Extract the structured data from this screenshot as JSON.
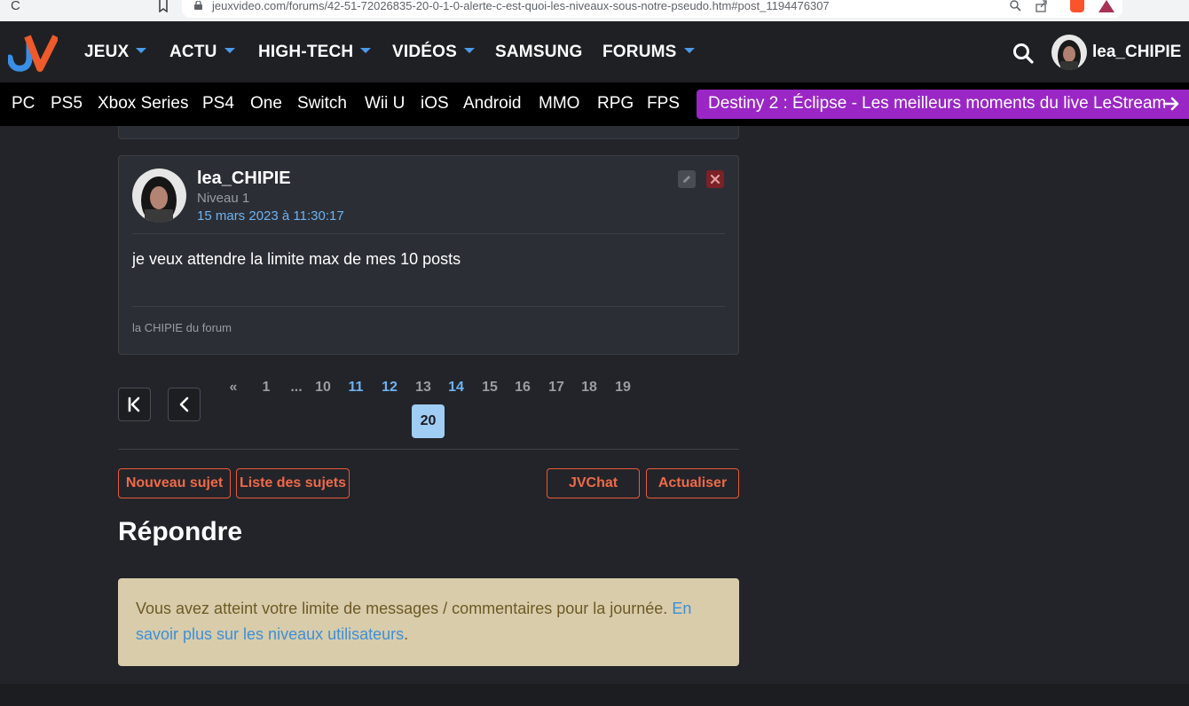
{
  "browser": {
    "url": "jeuxvideo.com/forums/42-51-72026835-20-0-1-0-alerte-c-est-quoi-les-niveaux-sous-notre-pseudo.htm#post_1194476307",
    "reload_icon": "C",
    "brave_badge": "1"
  },
  "header": {
    "logo": "JV",
    "nav": [
      {
        "label": "JEUX",
        "dropdown": true
      },
      {
        "label": "ACTU",
        "dropdown": true
      },
      {
        "label": "HIGH-TECH",
        "dropdown": true
      },
      {
        "label": "VIDÉOS",
        "dropdown": true
      },
      {
        "label": "SAMSUNG",
        "dropdown": false
      },
      {
        "label": "FORUMS",
        "dropdown": true
      }
    ],
    "username": "lea_CHIPIE"
  },
  "platforms": [
    "PC",
    "PS5",
    "Xbox Series",
    "PS4",
    "One",
    "Switch",
    "Wii U",
    "iOS",
    "Android",
    "MMO",
    "RPG",
    "FPS"
  ],
  "promo": {
    "text": "Destiny 2 : Éclipse - Les meilleurs moments du live LeStream",
    "color": "#9a27c5"
  },
  "post": {
    "author": "lea_CHIPIE",
    "level": "Niveau 1",
    "date": "15 mars 2023 à 11:30:17",
    "message": "je veux attendre la limite max de mes 10 posts",
    "signature": "la CHIPIE du forum"
  },
  "pagination": {
    "first": "«",
    "pages": [
      "1",
      "...",
      "10",
      "11",
      "12",
      "13",
      "14",
      "15",
      "16",
      "17",
      "18",
      "19"
    ],
    "current": "20"
  },
  "actions": {
    "new_topic": "Nouveau sujet",
    "topic_list": "Liste des sujets",
    "jvchat": "JVChat",
    "refresh": "Actualiser"
  },
  "reply": {
    "title": "Répondre",
    "notice_text": "Vous avez atteint votre limite de messages / commentaires pour la journée. ",
    "notice_link": "En savoir plus sur les niveaux utilisateurs",
    "notice_end": "."
  },
  "colors": {
    "accent_orange": "#ee6a48",
    "link_blue": "#6db3f2",
    "notice_bg": "#d8ccab",
    "background": "#232429"
  }
}
